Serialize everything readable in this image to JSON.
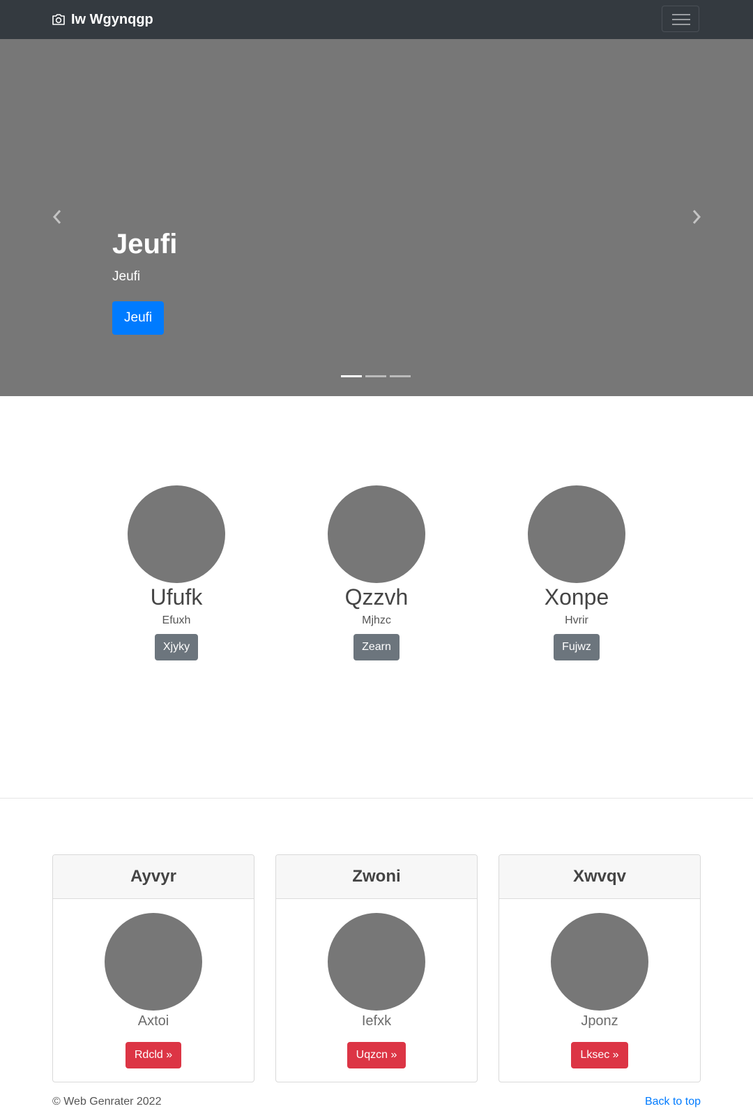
{
  "navbar": {
    "brand": "Iw Wgynqgp",
    "brand_icon": "camera-icon",
    "toggler_icon": "menu-icon"
  },
  "carousel": {
    "title": "Jeufi",
    "text": "Jeufi",
    "button": "Jeufi",
    "slide_count": 3,
    "active_slide": 1,
    "background": "#777777"
  },
  "features": [
    {
      "title": "Ufufk",
      "text": "Efuxh",
      "button": "Xjyky"
    },
    {
      "title": "Qzzvh",
      "text": "Mjhzc",
      "button": "Zearn"
    },
    {
      "title": "Xonpe",
      "text": "Hvrir",
      "button": "Fujwz"
    }
  ],
  "cards": [
    {
      "header": "Ayvyr",
      "label": "Axtoi",
      "button": "Rdcld »"
    },
    {
      "header": "Zwoni",
      "label": "Iefxk",
      "button": "Uqzcn »"
    },
    {
      "header": "Xwvqv",
      "label": "Jponz",
      "button": "Lksec »"
    }
  ],
  "footer": {
    "copyright": "© Web Genrater 2022",
    "back_to_top": "Back to top"
  },
  "colors": {
    "navbar": "#343a40",
    "primary": "#007bff",
    "secondary": "#6c757d",
    "danger": "#dc3545",
    "placeholder": "#777777"
  }
}
